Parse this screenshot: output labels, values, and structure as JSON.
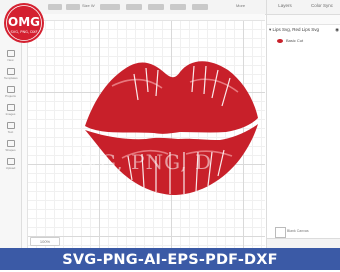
{
  "logo": {
    "brand": "OMG",
    "subtitle": "SVG, PNG, DXF",
    "color": "#d42030"
  },
  "topbar": {
    "size_label": "Size W",
    "more_label": "More"
  },
  "left_tools": [
    {
      "name": "new",
      "label": "New"
    },
    {
      "name": "templates",
      "label": "Templates"
    },
    {
      "name": "projects",
      "label": "Projects"
    },
    {
      "name": "images",
      "label": "Images"
    },
    {
      "name": "text",
      "label": "Text"
    },
    {
      "name": "shapes",
      "label": "Shapes"
    },
    {
      "name": "upload",
      "label": "Upload"
    }
  ],
  "canvas": {
    "zoom": "100%"
  },
  "right_panel": {
    "tabs": [
      "Layers",
      "Color Sync"
    ],
    "group_name": "Lips Svg, Red Lips Svg",
    "layer_name": "Basic Cut",
    "blank_canvas": "Blank Canvas"
  },
  "artwork": {
    "color": "#c8202a",
    "watermark": "SVG, PNG, D"
  },
  "banner": {
    "text": "SVG-PNG-AI-EPS-PDF-DXF",
    "color": "#3b5aa6"
  }
}
